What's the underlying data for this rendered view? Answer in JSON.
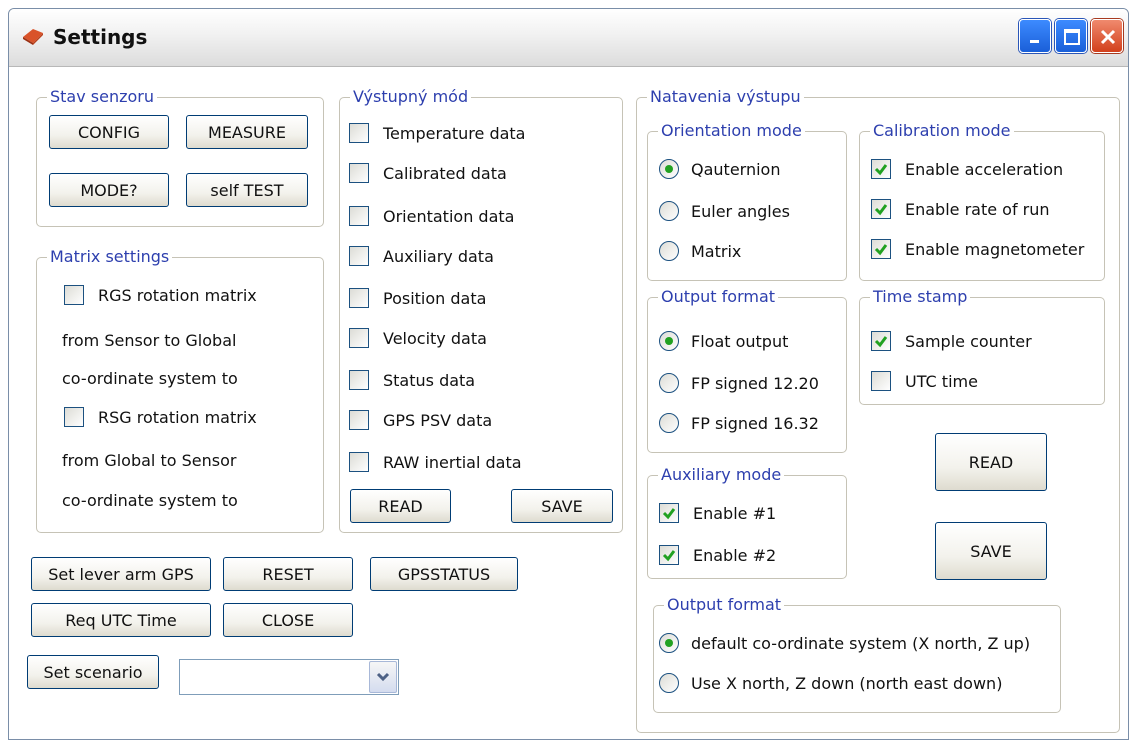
{
  "window": {
    "title": "Settings"
  },
  "stav_senzoru": {
    "legend": "Stav senzoru",
    "buttons": [
      "CONFIG",
      "MEASURE",
      "MODE?",
      "self TEST"
    ]
  },
  "matrix_settings": {
    "legend": "Matrix settings",
    "rgs_label": "RGS rotation matrix",
    "rgs_line1": "from Sensor to Global",
    "rgs_line2": "co-ordinate system to",
    "rsg_label": "RSG rotation matrix",
    "rsg_line1": "from Global to Sensor",
    "rsg_line2": "co-ordinate system to"
  },
  "vystupny_mod": {
    "legend": "Výstupný mód",
    "items": [
      "Temperature data",
      "Calibrated data",
      "Orientation data",
      "Auxiliary data",
      "Position data",
      "Velocity data",
      "Status data",
      "GPS PSV data",
      "RAW inertial data"
    ],
    "read": "READ",
    "save": "SAVE"
  },
  "bottom_buttons": {
    "set_lever": "Set lever arm GPS",
    "reset": "RESET",
    "gpsstatus": "GPSSTATUS",
    "req_utc": "Req UTC Time",
    "close": "CLOSE",
    "set_scenario": "Set scenario",
    "scenario_value": ""
  },
  "natavenia": {
    "legend": "Natavenia výstupu",
    "orientation": {
      "legend": "Orientation mode",
      "options": [
        "Qauternion",
        "Euler angles",
        "Matrix"
      ],
      "selected": 0
    },
    "calibration": {
      "legend": "Calibration mode",
      "options": [
        "Enable acceleration",
        "Enable rate of run",
        "Enable magnetometer"
      ],
      "checked": [
        true,
        true,
        true
      ]
    },
    "output_format": {
      "legend": "Output format",
      "options": [
        "Float output",
        "FP signed 12.20",
        "FP signed 16.32"
      ],
      "selected": 0
    },
    "time_stamp": {
      "legend": "Time stamp",
      "options": [
        "Sample counter",
        "UTC time"
      ],
      "checked": [
        true,
        false
      ]
    },
    "auxiliary": {
      "legend": "Auxiliary mode",
      "options": [
        "Enable #1",
        "Enable #2"
      ],
      "checked": [
        true,
        true
      ]
    },
    "read": "READ",
    "save": "SAVE",
    "output_format2": {
      "legend": "Output format",
      "options": [
        "default co-ordinate system (X north, Z up)",
        "Use X north, Z down (north east down)"
      ],
      "selected": 0
    }
  },
  "colors": {
    "legend_text": "#2d3fae",
    "check_green": "#21a121",
    "title_blue": "#1a5fd8"
  }
}
